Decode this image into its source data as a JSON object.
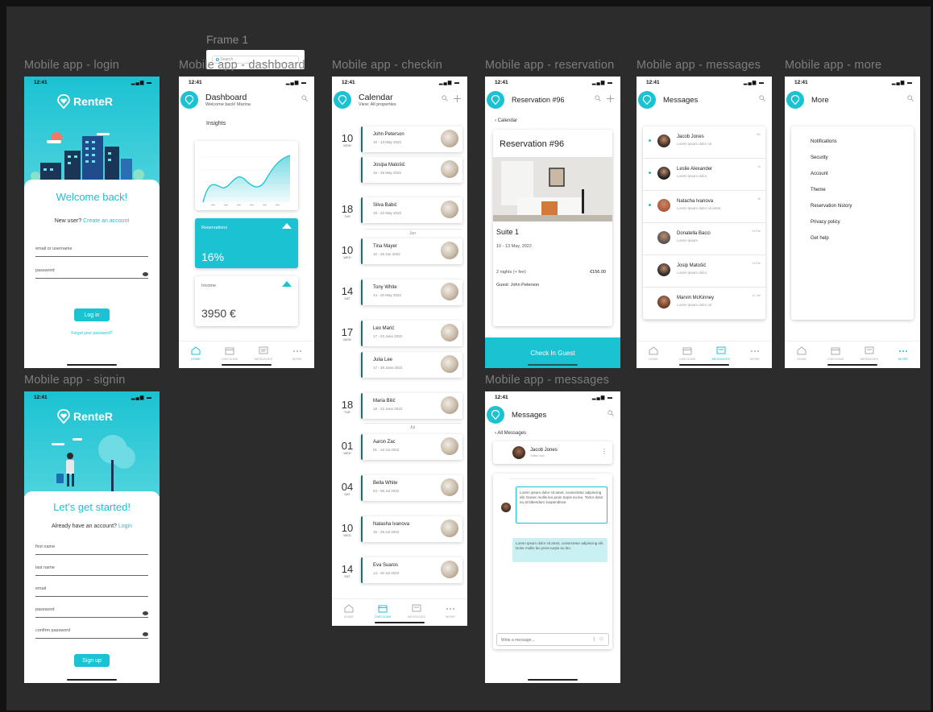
{
  "frame1": {
    "label": "Frame 1",
    "search_placeholder": "Search"
  },
  "labels": {
    "login": "Mobile app - login",
    "dashboard": "Mobile app - dashboard",
    "checkin": "Mobile app - checkin",
    "reservation": "Mobile app - reservation",
    "messages": "Mobile app - messages",
    "more": "Mobile app - more",
    "signin": "Mobile app - signin",
    "messages_chat": "Mobile app - messages"
  },
  "status_time": "12:41",
  "brand": {
    "name": "RenteR",
    "accent": "#1bc2d2",
    "dark_accent": "#1a6f6a"
  },
  "tabs": [
    "HOME",
    "CHECKINS",
    "MESSAGES",
    "MORE"
  ],
  "login": {
    "welcome": "Welcome back!",
    "new_user": "New user?",
    "create_account": "Create an account",
    "email_label": "email or username",
    "password_label": "password",
    "login_btn": "Log in",
    "forgot": "Forgot your password?"
  },
  "signin": {
    "title": "Let’s get started!",
    "already": "Already have an account?",
    "login_link": "Login",
    "fields": [
      "first name",
      "last name",
      "email",
      "password",
      "confirm password"
    ],
    "signup_btn": "Sign up"
  },
  "dashboard": {
    "title": "Dashboard",
    "subtitle": "Welcome back! Marina",
    "insights": "Insights",
    "reservations_label": "Reservations",
    "reservations_value": "16%",
    "income_label": "Income",
    "income_value": "3950 €"
  },
  "calendar": {
    "title": "Calendar",
    "subtitle": "View: All properties",
    "months": [
      "Jun",
      "Jul"
    ],
    "entries": [
      {
        "day": "10",
        "wday": "MON",
        "name": "John Peterson",
        "range": "10 - 13 May 2022"
      },
      {
        "day": "",
        "wday": "",
        "name": "Josipa Matošić",
        "range": "15 - 25 May 2022"
      },
      {
        "day": "18",
        "wday": "TUE",
        "name": "Silva Babić",
        "range": "18 - 22 May 2022"
      },
      {
        "day": "10",
        "wday": "WED",
        "name": "Tina Mayer",
        "range": "10 - 25 Jun 2022"
      },
      {
        "day": "14",
        "wday": "SAT",
        "name": "Tony White",
        "range": "14 - 20 May 2022"
      },
      {
        "day": "17",
        "wday": "MON",
        "name": "Leo Marić",
        "range": "17 - 23 June 2022"
      },
      {
        "day": "",
        "wday": "",
        "name": "Julia Lee",
        "range": "17 - 25 June 2022"
      },
      {
        "day": "18",
        "wday": "TUE",
        "name": "Maria Bilić",
        "range": "18 - 22 June 2022"
      },
      {
        "day": "01",
        "wday": "WED",
        "name": "Aaron Zac",
        "range": "01 - 10 Jul 2022"
      },
      {
        "day": "04",
        "wday": "SAT",
        "name": "Bella White",
        "range": "04 - 08 Jul 2022"
      },
      {
        "day": "10",
        "wday": "WED",
        "name": "Natasha Ivanova",
        "range": "15 - 25 Jul 2022"
      },
      {
        "day": "14",
        "wday": "SAT",
        "name": "Eva Suaros",
        "range": "14 - 20 Jul 2022"
      }
    ]
  },
  "reservation": {
    "header": "Reservation #96",
    "back": "Calendar",
    "card_title": "Reservation #96",
    "suite": "Suite 1",
    "dates": "10 - 13 May, 2022",
    "nights": "2 nights (+ fee)",
    "price": "€156.00",
    "guest": "Guest: John Peterson",
    "checkin_btn": "Check In Guest"
  },
  "messages": {
    "title": "Messages",
    "items": [
      {
        "name": "Jacob Jones",
        "preview": "Lorem ipsum dolor sit",
        "time": "5m"
      },
      {
        "name": "Leslie Alexander",
        "preview": "Lorem ipsum dolor",
        "time": "1h"
      },
      {
        "name": "Natacha Ivanova",
        "preview": "Lorem ipsum dolor sit amet",
        "time": "3h"
      },
      {
        "name": "Donatella Bacci",
        "preview": "Lorem ipsum",
        "time": "13 Feb"
      },
      {
        "name": "Josip Matošić",
        "preview": "Lorem ipsum dolor",
        "time": "13 Feb"
      },
      {
        "name": "Marvin McKinney",
        "preview": "Lorem ipsum dolor sit",
        "time": "12 Jan"
      }
    ]
  },
  "more": {
    "title": "More",
    "items": [
      "Notifications",
      "Security",
      "Account",
      "Theme",
      "Reservation history",
      "Privacy policy",
      "Get help"
    ]
  },
  "chat": {
    "title": "Messages",
    "back": "All Messages",
    "contact": "Jacob Jones",
    "contact_status": "Online now",
    "incoming": "Lorem ipsum dolor sit amet, consectetur adipiscing elit. Donec mollis leo proin turpis eu leo. Tortor dolor eu at bibendum suspendisse.",
    "outgoing": "Lorem ipsum dolor sit amet, consectetur adipiscing elit. Dolor mollis leo proin turpis eu leo.",
    "input_placeholder": "Write a message..."
  }
}
